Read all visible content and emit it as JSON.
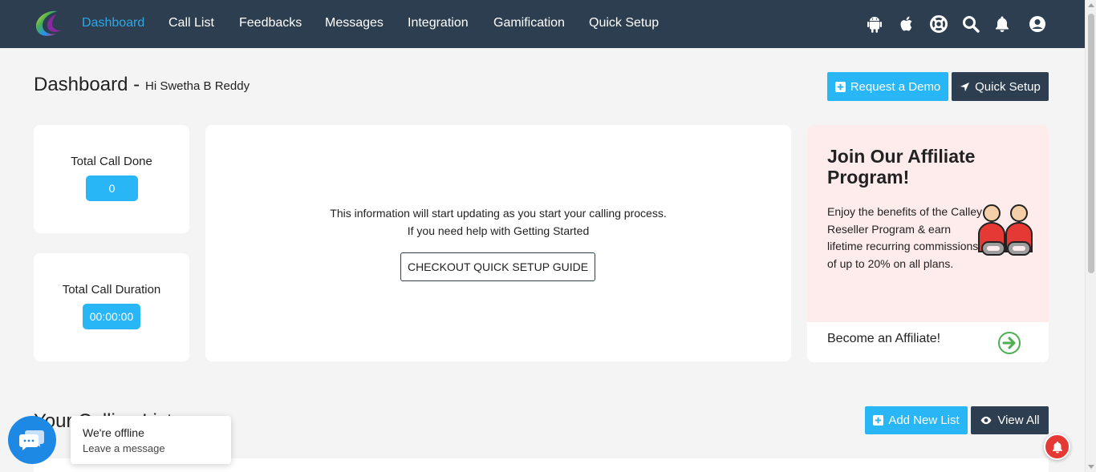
{
  "nav": {
    "items": [
      {
        "label": "Dashboard",
        "active": true
      },
      {
        "label": "Call List",
        "active": false
      },
      {
        "label": "Feedbacks",
        "active": false
      },
      {
        "label": "Messages",
        "active": false
      },
      {
        "label": "Integration",
        "active": false
      },
      {
        "label": "Gamification",
        "active": false
      },
      {
        "label": "Quick Setup",
        "active": false
      }
    ],
    "icons": [
      "android-icon",
      "apple-icon",
      "help-lifebuoy-icon",
      "search-icon",
      "bell-icon",
      "user-account-icon"
    ]
  },
  "header": {
    "title": "Dashboard -",
    "greeting": "Hi Swetha B Reddy",
    "request_demo_label": "Request a Demo",
    "quick_setup_label": "Quick Setup"
  },
  "stats": {
    "total_calls_label": "Total Call Done",
    "total_calls_value": "0",
    "total_duration_label": "Total Call Duration",
    "total_duration_value": "00:00:00"
  },
  "info": {
    "line1": "This information will start updating as you start your calling process.",
    "line2": "If you need help with Getting Started",
    "guide_button_label": "CHECKOUT QUICK SETUP GUIDE"
  },
  "affiliate": {
    "title": "Join Our Affiliate Program!",
    "description": "Enjoy the benefits of the Calley Reseller Program & earn lifetime recurring commissions of up to 20% on all plans.",
    "link_label": "Become an Affiliate!"
  },
  "calling_list": {
    "title": "Your Calling List",
    "add_label": "Add New List",
    "view_all_label": "View All"
  },
  "chat": {
    "status": "We're offline",
    "prompt": "Leave a message"
  },
  "colors": {
    "nav_bg": "#2c3e50",
    "accent_blue": "#29b6f6",
    "active_nav": "#2ea8e6",
    "affiliate_bg": "#fdeceb"
  }
}
